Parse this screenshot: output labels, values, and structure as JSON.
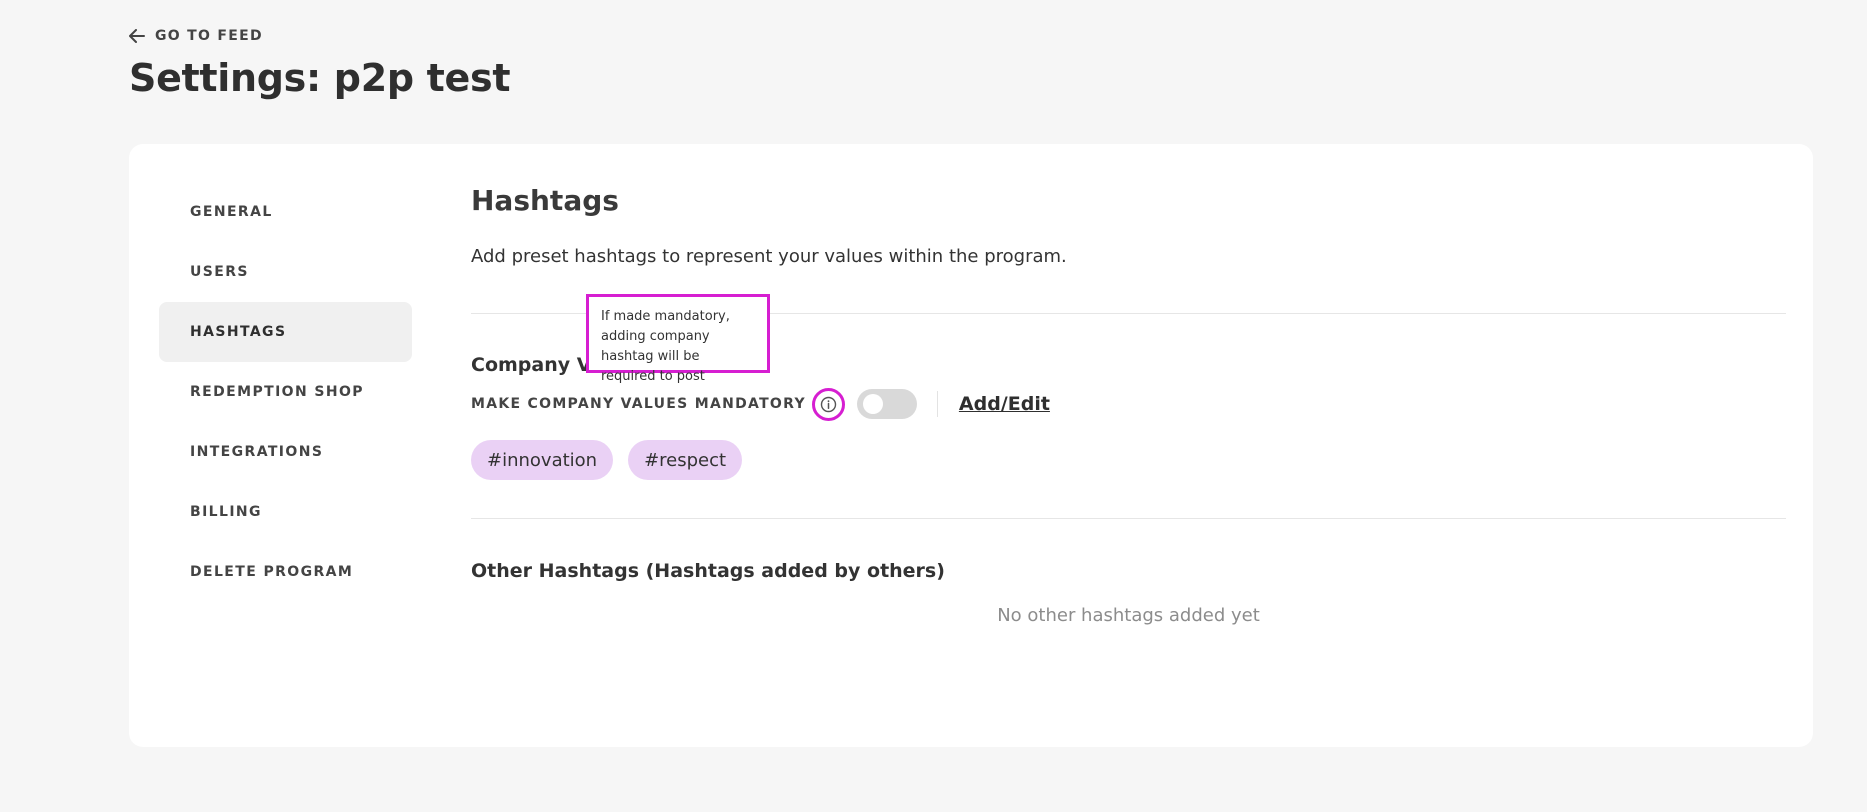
{
  "header": {
    "back_label": "GO TO FEED",
    "page_title": "Settings: p2p test"
  },
  "sidebar": {
    "items": [
      {
        "label": "GENERAL"
      },
      {
        "label": "USERS"
      },
      {
        "label": "HASHTAGS",
        "active": true
      },
      {
        "label": "REDEMPTION SHOP"
      },
      {
        "label": "INTEGRATIONS"
      },
      {
        "label": "BILLING"
      },
      {
        "label": "DELETE PROGRAM"
      }
    ]
  },
  "main": {
    "title": "Hashtags",
    "description": "Add preset hashtags to represent your values within the program.",
    "company_values": {
      "label": "Company Va",
      "mandatory_label": "MAKE COMPANY VALUES MANDATORY",
      "info_icon": "info-circle-icon",
      "toggle_on": false,
      "add_edit_label": "Add/Edit",
      "tooltip": "If made mandatory, adding company hashtag will be required to post",
      "tags": [
        "#innovation",
        "#respect"
      ]
    },
    "other_hashtags": {
      "title": "Other Hashtags (Hashtags added by others)",
      "empty_text": "No other hashtags added yet"
    }
  },
  "colors": {
    "highlight": "#d61ed1",
    "tag_bg": "#ead1f5",
    "page_bg": "#f6f6f6",
    "active_nav_bg": "#f0f0f0"
  }
}
